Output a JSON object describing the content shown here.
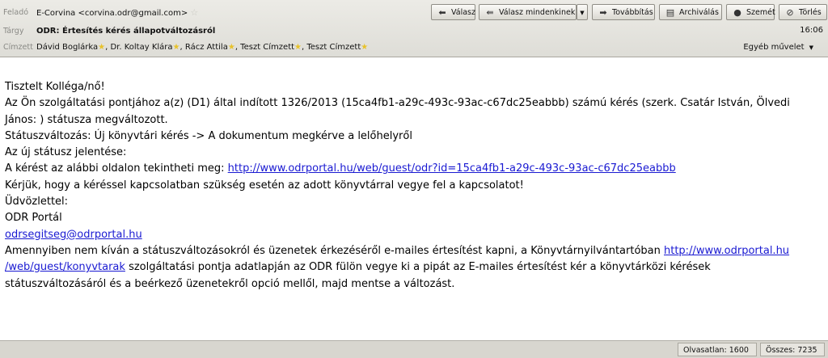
{
  "header": {
    "from_label": "Feladó",
    "from_value": "E-Corvina <corvina.odr@gmail.com>",
    "subject_label": "Tárgy",
    "subject_value": "ODR: Értesítés kérés állapotváltozásról",
    "time": "16:06",
    "to_label": "Címzett",
    "recipients": [
      "Dávid Boglárka",
      "Dr. Koltay Klára",
      "Rácz Attila",
      "Teszt Címzett",
      "Teszt Címzett"
    ],
    "more_actions": "Egyéb művelet"
  },
  "toolbar": {
    "reply": "Válasz",
    "reply_all": "Válasz mindenkinek",
    "forward": "Továbbítás",
    "archive": "Archiválás",
    "junk": "Szemét",
    "delete": "Törlés"
  },
  "body": {
    "greeting": "Tisztelt Kolléga/nő!",
    "line1": "Az Ön szolgáltatási pontjához a(z) (D1) által indított 1326/2013 (15ca4fb1-a29c-493c-93ac-c67dc25eabbb) számú kérés (szerk. Csatár István, Ölvedi",
    "line2": "János: ) státusza megváltozott.",
    "status_change": "Státuszváltozás: Új könyvtári kérés -> A dokumentum megkérve a lelőhelyről",
    "new_status_meaning": "Az új státusz jelentése:",
    "view_prefix": "A kérést az alábbi oldalon tekintheti meg: ",
    "view_link": "http://www.odrportal.hu/web/guest/odr?id=15ca4fb1-a29c-493c-93ac-c67dc25eabbb",
    "contact": "Kérjük, hogy a kéréssel kapcsolatban szükség esetén az adott könyvtárral vegye fel a kapcsolatot!",
    "regards": "Üdvözlettel:",
    "signature": "ODR Portál",
    "email_link": "odrsegitseg@odrportal.hu",
    "unsub_prefix": "Amennyiben nem kíván a státuszváltozásokról és üzenetek érkezéséről e-mailes értesítést kapni, a Könyvtárnyilvántartóban ",
    "unsub_link_part1": "http://www.odrportal.hu",
    "unsub_link_part2": "/web/guest/konyvtarak",
    "unsub_mid": " szolgáltatási pontja adatlapján az ODR fülön vegye ki a pipát az E-mailes értesítést kér a könyvtárközi kérések",
    "unsub_end": "státuszváltozásáról és a beérkező üzenetekről opció mellől, majd mentse a változást."
  },
  "statusbar": {
    "unread": "Olvasatlan: 1600",
    "total": "Összes: 7235"
  }
}
